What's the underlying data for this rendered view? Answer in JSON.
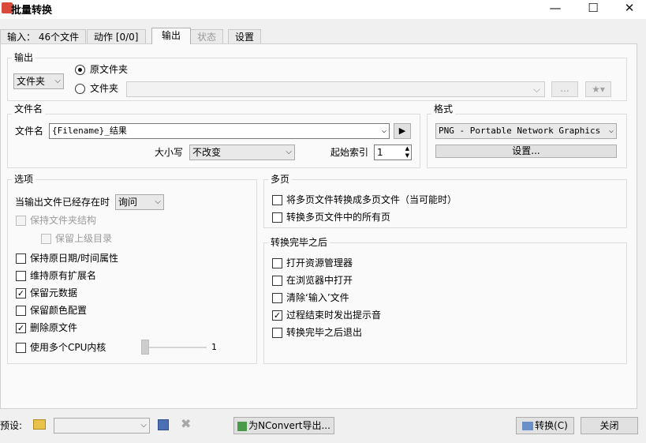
{
  "window": {
    "title": "批量转换",
    "minimize": "—",
    "maximize": "☐",
    "close": "✕"
  },
  "tabs": [
    {
      "label": "输入： 46个文件"
    },
    {
      "label": "动作 [0/0]"
    },
    {
      "label": "输出"
    },
    {
      "label": "状态"
    },
    {
      "label": "设置"
    }
  ],
  "output": {
    "group_label": "输出",
    "dest_type": "文件夹",
    "radio_source": "原文件夹",
    "radio_folder": "文件夹",
    "folder_path": "",
    "browse_label": "...",
    "fav_label": "★▾"
  },
  "filename": {
    "group_label": "文件名",
    "label": "文件名",
    "value": "{Filename}_结果",
    "play_label": "▶",
    "case_label": "大小写",
    "case_value": "不改变",
    "start_index_label": "起始索引",
    "start_index_value": "1"
  },
  "format": {
    "group_label": "格式",
    "value": "PNG - Portable Network Graphics",
    "settings_label": "设置..."
  },
  "options": {
    "group_label": "选项",
    "exists_label": "当输出文件已经存在时",
    "exists_value": "询问",
    "keep_folder": "保持文件夹结构",
    "keep_parent": "保留上级目录",
    "keep_date": "保持原日期/时间属性",
    "keep_ext": "维持原有扩展名",
    "keep_meta": "保留元数据",
    "keep_color": "保留颜色配置",
    "delete_orig": "删除原文件",
    "multi_cpu": "使用多个CPU内核",
    "cpu_value": "1"
  },
  "multipage": {
    "group_label": "多页",
    "to_multipage": "将多页文件转换成多页文件（当可能时）",
    "all_pages": "转换多页文件中的所有页"
  },
  "after": {
    "group_label": "转换完毕之后",
    "open_explorer": "打开资源管理器",
    "open_browser": "在浏览器中打开",
    "clear_input": "清除‘输入’文件",
    "beep": "过程结束时发出提示音",
    "exit": "转换完毕之后退出"
  },
  "bottom": {
    "preset_label": "预设:",
    "preset_value": "",
    "nconvert_label": "为NConvert导出...",
    "convert_label": "转换(C)",
    "close_label": "关闭"
  },
  "checked": {
    "keep_folder": false,
    "keep_parent": false,
    "keep_date": false,
    "keep_ext": false,
    "keep_meta": true,
    "keep_color": false,
    "delete_orig": true,
    "multi_cpu": false,
    "to_multipage": false,
    "all_pages": false,
    "open_explorer": false,
    "open_browser": false,
    "clear_input": false,
    "beep": true,
    "exit": false
  },
  "colors": {
    "accent": "#d94a3a",
    "panel_bg": "#fafafa",
    "window_bg": "#f0f0f0"
  }
}
